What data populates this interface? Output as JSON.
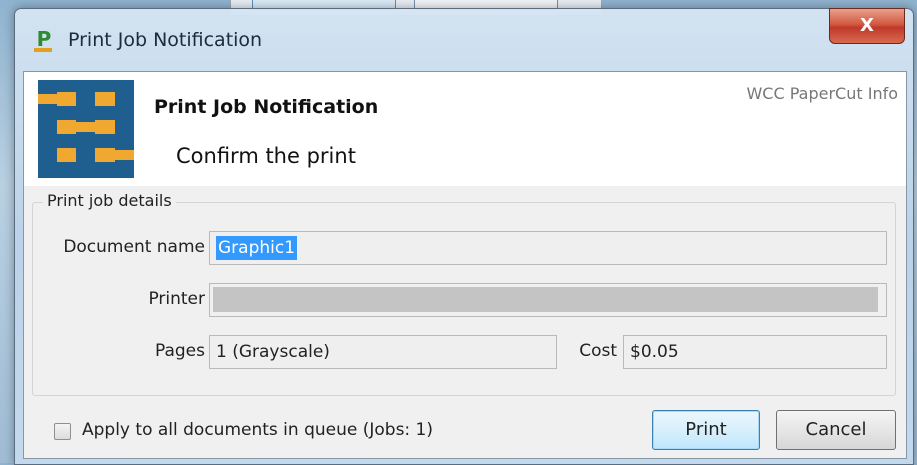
{
  "dialog": {
    "title": "Print Job Notification",
    "app_icon": "papercut-p-icon",
    "close_glyph": "X"
  },
  "header": {
    "title": "Print Job Notification",
    "subtitle": "Confirm the print",
    "info": "WCC PaperCut Info",
    "logo_colors": [
      "#1f5f8f",
      "#f0a830"
    ]
  },
  "details": {
    "legend": "Print job details",
    "document_name_label": "Document name",
    "document_name_value": "Graphic1",
    "printer_label": "Printer",
    "printer_value": "",
    "pages_label": "Pages",
    "pages_value": "1  (Grayscale)",
    "cost_label": "Cost",
    "cost_value": "$0.05"
  },
  "footer": {
    "apply_all_label": "Apply to all documents in queue (Jobs: 1)",
    "apply_all_checked": false,
    "print_button": "Print",
    "cancel_button": "Cancel"
  }
}
